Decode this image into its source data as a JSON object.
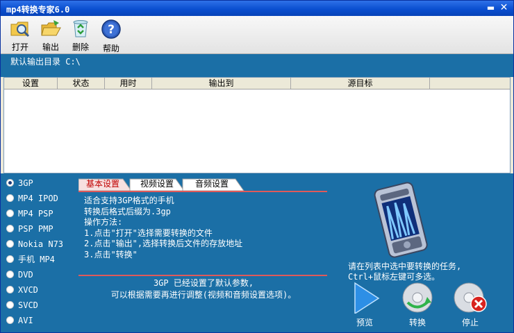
{
  "window": {
    "title": "mp4转换专家6.0"
  },
  "toolbar": {
    "open_label": "打开",
    "output_label": "输出",
    "delete_label": "删除",
    "help_label": "帮助"
  },
  "output_dir": {
    "text": "默认输出目录 C:\\"
  },
  "list": {
    "columns": [
      "设置",
      "状态",
      "用时",
      "输出到",
      "源目标"
    ]
  },
  "formats": {
    "selected": "3GP",
    "items": [
      "3GP",
      "MP4 IPOD",
      "MP4 PSP",
      "PSP PMP",
      "Nokia N73",
      "手机 MP4",
      "DVD",
      "XVCD",
      "SVCD",
      "AVI"
    ]
  },
  "tabs": {
    "basic": "基本设置",
    "video": "视频设置",
    "audio": "音频设置"
  },
  "info_text": {
    "line1": "适合支持3GP格式的手机",
    "line2": "转换后格式后缀为.3gp",
    "line3": "操作方法:",
    "line4": "1.点击\"打开\"选择需要转换的文件",
    "line5": "2.点击\"输出\",选择转换后文件的存放地址",
    "line6": "3.点击\"转换\""
  },
  "note": {
    "line1": "3GP 已经设置了默认参数,",
    "line2": "可以根据需要再进行调整(视频和音频设置选项)。"
  },
  "hint": {
    "line1": "请在列表中选中要转换的任务,",
    "line2": "Ctrl+鼠标左键可多选。"
  },
  "actions": {
    "preview": "预览",
    "convert": "转换",
    "stop": "停止"
  },
  "icons": {
    "open": "folder-search-icon",
    "output": "folder-open-icon",
    "delete": "recycle-icon",
    "help": "help-icon",
    "preview": "play-icon",
    "convert": "disc-convert-icon",
    "stop": "disc-stop-icon",
    "phone": "phone-image"
  },
  "colors": {
    "titlebar": "#0A4FD0",
    "panel": "#1B6FA6",
    "active_tab_text": "#C00000",
    "accent_line": "#E05A5A"
  }
}
